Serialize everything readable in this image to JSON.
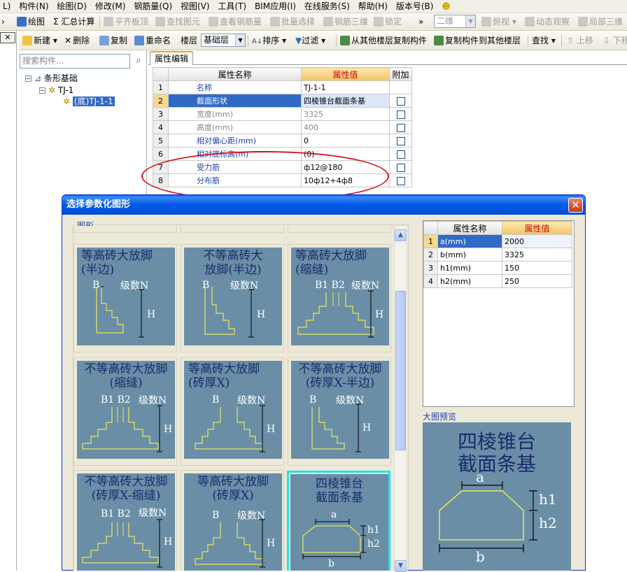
{
  "menubar": [
    "L)",
    "构件(N)",
    "绘图(D)",
    "修改(M)",
    "钢筋量(Q)",
    "视图(V)",
    "工具(T)",
    "BIM应用(I)",
    "在线服务(S)",
    "帮助(H)",
    "版本号(B)"
  ],
  "toolbar1": {
    "draw": "绘图",
    "sum_calc": "Σ 汇总计算",
    "align_slab": "平齐板顶",
    "find_element": "查找图元",
    "view_rebar_qty": "查看钢筋量",
    "batch_select": "批量选择",
    "rebar_3d": "钢筋三维",
    "lock": "锁定",
    "view_mode": "二维",
    "top_view": "俯视",
    "dynamic_view": "动态观察",
    "local_3d": "局部三维"
  },
  "toolbar2": {
    "new": "新建",
    "delete": "删除",
    "copy": "复制",
    "rename": "重命名",
    "floor_label": "楼层",
    "floor_value": "基础层",
    "sort": "排序",
    "filter": "过滤",
    "copy_from_other_floor": "从其他楼层复制构件",
    "copy_to_other_floor": "复制构件到其他楼层",
    "find": "查找",
    "move_up": "上移",
    "move_down": "下移"
  },
  "tree": {
    "search_placeholder": "搜索构件...",
    "root": "条形基础",
    "child": "TJ-1",
    "leaf": "(底)TJ-1-1"
  },
  "prop_tab": "属性编辑",
  "prop_grid": {
    "headers": [
      "属性名称",
      "属性值",
      "附加"
    ],
    "rows": [
      {
        "n": "1",
        "name": "名称",
        "value": "TJ-1-1"
      },
      {
        "n": "2",
        "name": "截面形状",
        "value": "四棱锥台截面条基"
      },
      {
        "n": "3",
        "name": "宽度(mm)",
        "value": "3325"
      },
      {
        "n": "4",
        "name": "高度(mm)",
        "value": "400"
      },
      {
        "n": "5",
        "name": "相对偏心距(mm)",
        "value": "0"
      },
      {
        "n": "6",
        "name": "相对底标高(m)",
        "value": "(0)"
      },
      {
        "n": "7",
        "name": "受力筋",
        "value": "ф12@180"
      },
      {
        "n": "8",
        "name": "分布筋",
        "value": "10ф12+4ф8"
      }
    ]
  },
  "dialog": {
    "title": "选择参数化图形",
    "close": "✕",
    "group_label": "图形",
    "shapes": [
      {
        "title": "等高砖大放脚\n(半边)",
        "b": "B",
        "n": "级数N",
        "h": "H"
      },
      {
        "title": "不等高砖大\n放脚(半边)",
        "b": "B",
        "n": "级数N",
        "h": "H"
      },
      {
        "title": "等高砖大放脚\n(缩缝)",
        "b": "B1  B2",
        "n": "级数N",
        "h": "H"
      },
      {
        "title": "不等高砖大放脚\n(缩缝)",
        "b": "B1  B2",
        "n": "级数N",
        "h": "H"
      },
      {
        "title": "等高砖大放脚\n(砖厚X)",
        "b": "B",
        "n": "级数N",
        "h": "H"
      },
      {
        "title": "不等高砖大放脚\n(砖厚X-半边)",
        "b": "B",
        "n": "级数N",
        "h": "H"
      },
      {
        "title": "不等高砖大放脚\n(砖厚X-缩缝)",
        "b": "B1  B2",
        "n": "级数N",
        "h": "H"
      },
      {
        "title": "等高砖大放脚\n(砖厚X)",
        "b": "B",
        "n": "级数N",
        "h": "H"
      },
      {
        "title": "四棱锥台\n截面条基",
        "a": "a",
        "b": "b",
        "h1": "h1",
        "h2": "h2"
      }
    ],
    "param_grid": {
      "headers": [
        "属性名称",
        "属性值"
      ],
      "rows": [
        {
          "n": "1",
          "name": "a(mm)",
          "value": "2000"
        },
        {
          "n": "2",
          "name": "b(mm)",
          "value": "3325"
        },
        {
          "n": "3",
          "name": "h1(mm)",
          "value": "150"
        },
        {
          "n": "4",
          "name": "h2(mm)",
          "value": "250"
        }
      ]
    },
    "preview_label": "大图预览",
    "preview": {
      "title": "四棱锥台\n截面条基",
      "a": "a",
      "b": "b",
      "h1": "h1",
      "h2": "h2"
    }
  },
  "colors": {
    "accent": "#316ac5",
    "title_blue": "#0058e6",
    "highlight": "#22e3ee",
    "annotation": "#d4141b",
    "shape_bg": "#6a8ea6",
    "shape_line": "#e8e85a"
  }
}
